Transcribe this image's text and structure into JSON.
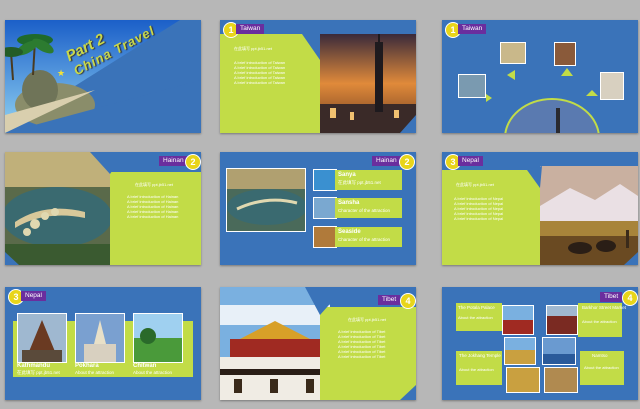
{
  "slides": {
    "s1": {
      "title_line1": "Part 2",
      "title_line2": "China Travel"
    },
    "s2": {
      "num": "1",
      "tag": "Taiwan",
      "sub": "在此填写 ppt.jb51.net",
      "lines": [
        "A brief introduction of Taiwan",
        "A brief introduction of Taiwan",
        "A brief introduction of Taiwan",
        "A brief introduction of Taiwan",
        "A brief introduction of Taiwan"
      ]
    },
    "s3": {
      "num": "1",
      "tag": "Taiwan"
    },
    "s4": {
      "num": "2",
      "tag": "Hainan",
      "sub": "在此填写 ppt.jb51.net",
      "lines": [
        "A brief introduction of Hainan",
        "A brief introduction of Hainan",
        "A brief introduction of Hainan",
        "A brief introduction of Hainan",
        "A brief introduction of Hainan"
      ]
    },
    "s5": {
      "num": "2",
      "tag": "Hainan",
      "items": [
        {
          "name": "Sanya",
          "desc": "在此填写 ppt.jb51.net"
        },
        {
          "name": "Sansha",
          "desc": "Character of the attraction"
        },
        {
          "name": "Seaside",
          "desc": "Character of the attraction"
        }
      ]
    },
    "s6": {
      "num": "3",
      "tag": "Nepal",
      "sub": "在此填写 ppt.jb51.net",
      "lines": [
        "A brief introduction of Nepal",
        "A brief introduction of Nepal",
        "A brief introduction of Nepal",
        "A brief introduction of Nepal",
        "A brief introduction of Nepal"
      ]
    },
    "s7": {
      "num": "3",
      "tag": "Nepal",
      "items": [
        {
          "name": "Kathmandu",
          "desc": "在此填写 ppt.jb51.net"
        },
        {
          "name": "Pokhara",
          "desc": "About the attraction"
        },
        {
          "name": "Chitwan",
          "desc": "About the attraction"
        }
      ]
    },
    "s8": {
      "num": "4",
      "tag": "Tibet",
      "sub": "在此填写 ppt.jb51.net",
      "lines": [
        "A brief introduction of Tibet",
        "A brief introduction of Tibet",
        "A brief introduction of Tibet",
        "A brief introduction of Tibet",
        "A brief introduction of Tibet",
        "A brief introduction of Tibet"
      ]
    },
    "s9": {
      "num": "4",
      "tag": "Tibet",
      "palace": "The Potala Palace",
      "bakhor": "Barkhor Street Market",
      "jokhang": "The Jokhang Temple",
      "namtso": "Namtso",
      "about": "About the attraction"
    }
  },
  "colors": {
    "slide_bg": "#3a73b9",
    "accent": "#c2dc47",
    "badge": "#e8d51a",
    "tag": "#6a2e9e"
  }
}
